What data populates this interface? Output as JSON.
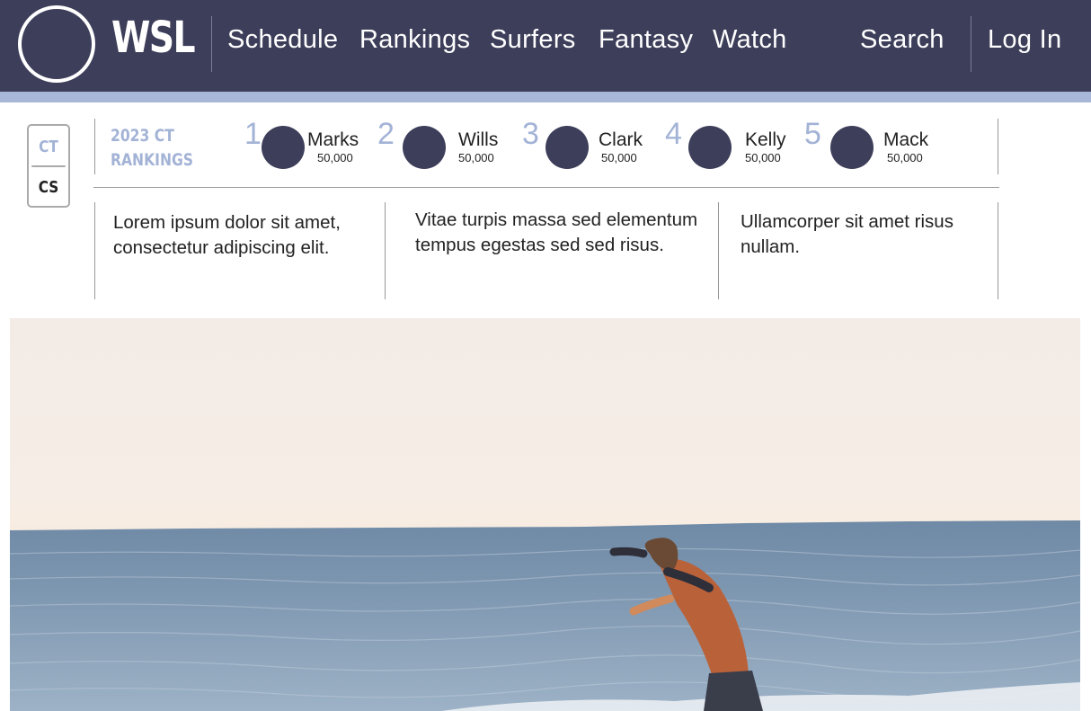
{
  "header": {
    "logo_text": "WSL",
    "nav": [
      "Schedule",
      "Rankings",
      "Surfers",
      "Fantasy",
      "Watch"
    ],
    "search_label": "Search",
    "login_label": "Log In"
  },
  "toggle": {
    "ct_label": "CT",
    "cs_label": "CS"
  },
  "rankings": {
    "title_line1": "2023 CT",
    "title_line2": "RANKINGS",
    "entries": [
      {
        "rank": "1",
        "name": "Marks",
        "points": "50,000"
      },
      {
        "rank": "2",
        "name": "Wills",
        "points": "50,000"
      },
      {
        "rank": "3",
        "name": "Clark",
        "points": "50,000"
      },
      {
        "rank": "4",
        "name": "Kelly",
        "points": "50,000"
      },
      {
        "rank": "5",
        "name": "Mack",
        "points": "50,000"
      }
    ]
  },
  "articles": [
    {
      "text": "Lorem ipsum dolor sit amet, consectetur adipiscing elit."
    },
    {
      "text": "Vitae turpis massa sed elementum tempus egestas sed sed risus."
    },
    {
      "text": "Ullamcorper sit amet risus nullam."
    }
  ],
  "colors": {
    "header_bg": "#3d3e5a",
    "accent": "#a3b3d6",
    "avatar": "#3d3e5a"
  }
}
